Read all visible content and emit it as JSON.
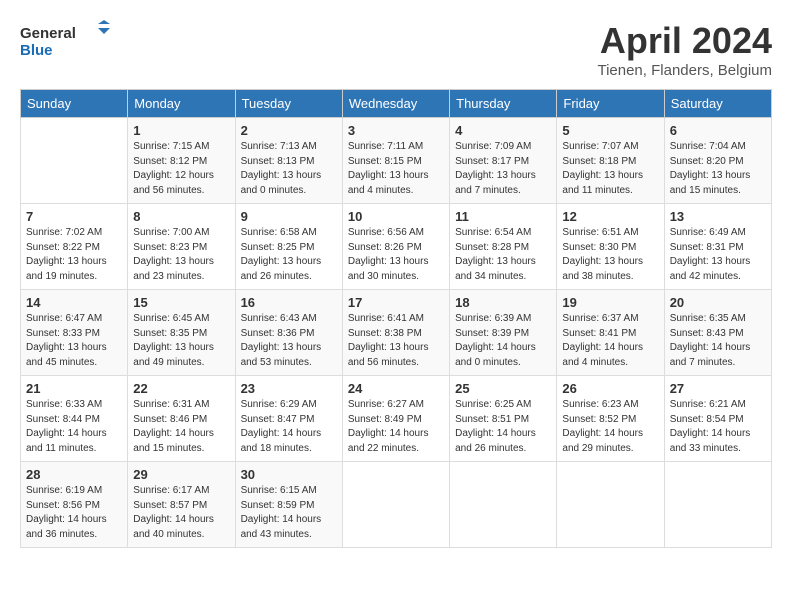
{
  "logo": {
    "line1": "General",
    "line2": "Blue"
  },
  "title": "April 2024",
  "subtitle": "Tienen, Flanders, Belgium",
  "days_of_week": [
    "Sunday",
    "Monday",
    "Tuesday",
    "Wednesday",
    "Thursday",
    "Friday",
    "Saturday"
  ],
  "weeks": [
    [
      {
        "day": "",
        "info": ""
      },
      {
        "day": "1",
        "info": "Sunrise: 7:15 AM\nSunset: 8:12 PM\nDaylight: 12 hours and 56 minutes."
      },
      {
        "day": "2",
        "info": "Sunrise: 7:13 AM\nSunset: 8:13 PM\nDaylight: 13 hours and 0 minutes."
      },
      {
        "day": "3",
        "info": "Sunrise: 7:11 AM\nSunset: 8:15 PM\nDaylight: 13 hours and 4 minutes."
      },
      {
        "day": "4",
        "info": "Sunrise: 7:09 AM\nSunset: 8:17 PM\nDaylight: 13 hours and 7 minutes."
      },
      {
        "day": "5",
        "info": "Sunrise: 7:07 AM\nSunset: 8:18 PM\nDaylight: 13 hours and 11 minutes."
      },
      {
        "day": "6",
        "info": "Sunrise: 7:04 AM\nSunset: 8:20 PM\nDaylight: 13 hours and 15 minutes."
      }
    ],
    [
      {
        "day": "7",
        "info": "Sunrise: 7:02 AM\nSunset: 8:22 PM\nDaylight: 13 hours and 19 minutes."
      },
      {
        "day": "8",
        "info": "Sunrise: 7:00 AM\nSunset: 8:23 PM\nDaylight: 13 hours and 23 minutes."
      },
      {
        "day": "9",
        "info": "Sunrise: 6:58 AM\nSunset: 8:25 PM\nDaylight: 13 hours and 26 minutes."
      },
      {
        "day": "10",
        "info": "Sunrise: 6:56 AM\nSunset: 8:26 PM\nDaylight: 13 hours and 30 minutes."
      },
      {
        "day": "11",
        "info": "Sunrise: 6:54 AM\nSunset: 8:28 PM\nDaylight: 13 hours and 34 minutes."
      },
      {
        "day": "12",
        "info": "Sunrise: 6:51 AM\nSunset: 8:30 PM\nDaylight: 13 hours and 38 minutes."
      },
      {
        "day": "13",
        "info": "Sunrise: 6:49 AM\nSunset: 8:31 PM\nDaylight: 13 hours and 42 minutes."
      }
    ],
    [
      {
        "day": "14",
        "info": "Sunrise: 6:47 AM\nSunset: 8:33 PM\nDaylight: 13 hours and 45 minutes."
      },
      {
        "day": "15",
        "info": "Sunrise: 6:45 AM\nSunset: 8:35 PM\nDaylight: 13 hours and 49 minutes."
      },
      {
        "day": "16",
        "info": "Sunrise: 6:43 AM\nSunset: 8:36 PM\nDaylight: 13 hours and 53 minutes."
      },
      {
        "day": "17",
        "info": "Sunrise: 6:41 AM\nSunset: 8:38 PM\nDaylight: 13 hours and 56 minutes."
      },
      {
        "day": "18",
        "info": "Sunrise: 6:39 AM\nSunset: 8:39 PM\nDaylight: 14 hours and 0 minutes."
      },
      {
        "day": "19",
        "info": "Sunrise: 6:37 AM\nSunset: 8:41 PM\nDaylight: 14 hours and 4 minutes."
      },
      {
        "day": "20",
        "info": "Sunrise: 6:35 AM\nSunset: 8:43 PM\nDaylight: 14 hours and 7 minutes."
      }
    ],
    [
      {
        "day": "21",
        "info": "Sunrise: 6:33 AM\nSunset: 8:44 PM\nDaylight: 14 hours and 11 minutes."
      },
      {
        "day": "22",
        "info": "Sunrise: 6:31 AM\nSunset: 8:46 PM\nDaylight: 14 hours and 15 minutes."
      },
      {
        "day": "23",
        "info": "Sunrise: 6:29 AM\nSunset: 8:47 PM\nDaylight: 14 hours and 18 minutes."
      },
      {
        "day": "24",
        "info": "Sunrise: 6:27 AM\nSunset: 8:49 PM\nDaylight: 14 hours and 22 minutes."
      },
      {
        "day": "25",
        "info": "Sunrise: 6:25 AM\nSunset: 8:51 PM\nDaylight: 14 hours and 26 minutes."
      },
      {
        "day": "26",
        "info": "Sunrise: 6:23 AM\nSunset: 8:52 PM\nDaylight: 14 hours and 29 minutes."
      },
      {
        "day": "27",
        "info": "Sunrise: 6:21 AM\nSunset: 8:54 PM\nDaylight: 14 hours and 33 minutes."
      }
    ],
    [
      {
        "day": "28",
        "info": "Sunrise: 6:19 AM\nSunset: 8:56 PM\nDaylight: 14 hours and 36 minutes."
      },
      {
        "day": "29",
        "info": "Sunrise: 6:17 AM\nSunset: 8:57 PM\nDaylight: 14 hours and 40 minutes."
      },
      {
        "day": "30",
        "info": "Sunrise: 6:15 AM\nSunset: 8:59 PM\nDaylight: 14 hours and 43 minutes."
      },
      {
        "day": "",
        "info": ""
      },
      {
        "day": "",
        "info": ""
      },
      {
        "day": "",
        "info": ""
      },
      {
        "day": "",
        "info": ""
      }
    ]
  ]
}
